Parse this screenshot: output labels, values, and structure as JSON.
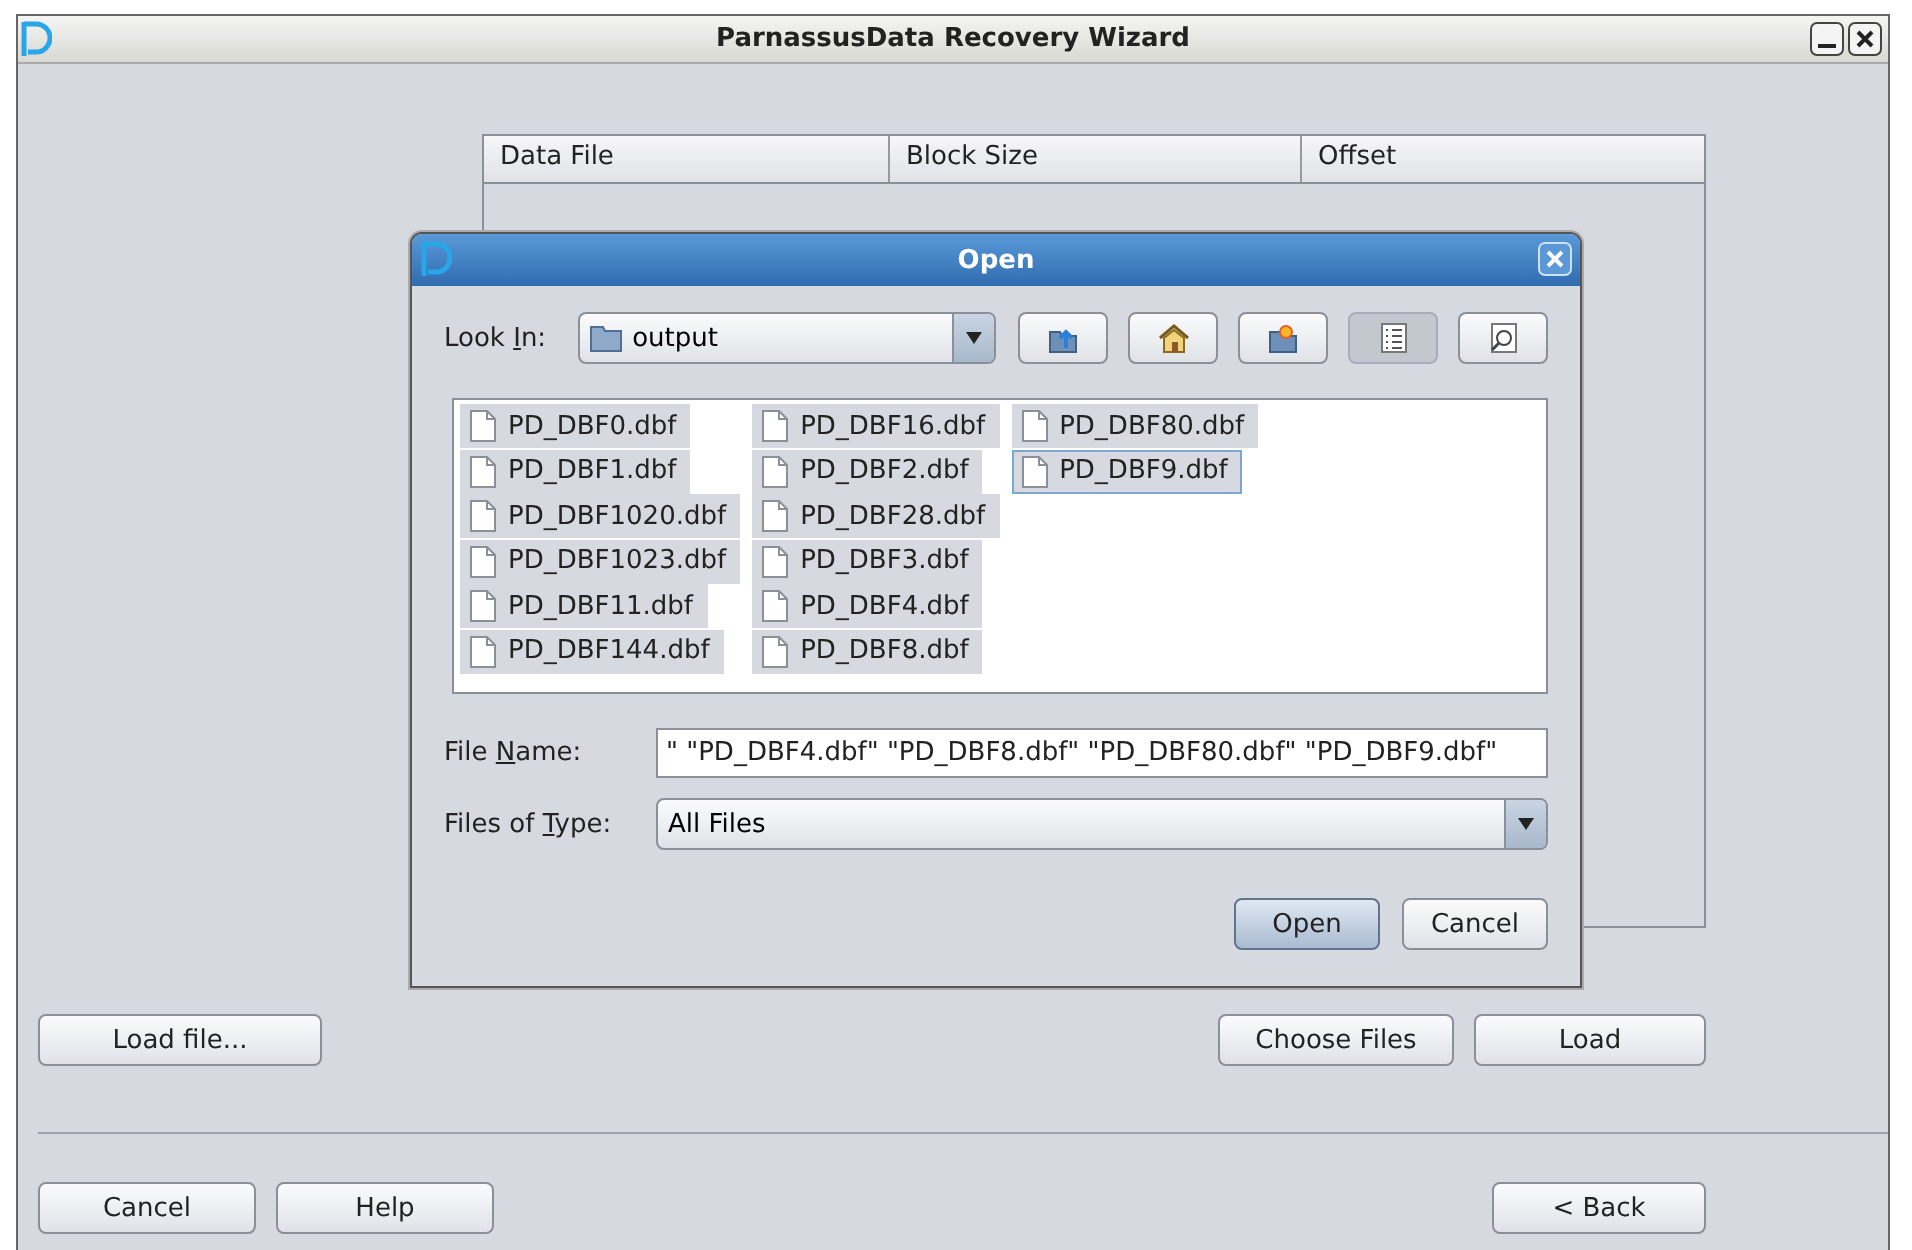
{
  "window": {
    "title": "ParnassusData Recovery Wizard"
  },
  "table": {
    "columns": [
      "Data File",
      "Block Size",
      "Offset"
    ]
  },
  "dialog": {
    "title": "Open",
    "look_in": {
      "label": [
        "Look ",
        "I",
        "n:"
      ],
      "value": "output"
    },
    "toolbar": [
      {
        "kind": "up",
        "selected": false
      },
      {
        "kind": "home",
        "selected": false
      },
      {
        "kind": "new-folder",
        "selected": false
      },
      {
        "kind": "list",
        "selected": true
      },
      {
        "kind": "details",
        "selected": false
      }
    ],
    "files": [
      {
        "name": "PD_DBF0.dbf",
        "selected": true,
        "focused": false
      },
      {
        "name": "PD_DBF1.dbf",
        "selected": true,
        "focused": false
      },
      {
        "name": "PD_DBF1020.dbf",
        "selected": true,
        "focused": false
      },
      {
        "name": "PD_DBF1023.dbf",
        "selected": true,
        "focused": false
      },
      {
        "name": "PD_DBF11.dbf",
        "selected": true,
        "focused": false
      },
      {
        "name": "PD_DBF144.dbf",
        "selected": true,
        "focused": false
      },
      {
        "name": "PD_DBF16.dbf",
        "selected": true,
        "focused": false
      },
      {
        "name": "PD_DBF2.dbf",
        "selected": true,
        "focused": false
      },
      {
        "name": "PD_DBF28.dbf",
        "selected": true,
        "focused": false
      },
      {
        "name": "PD_DBF3.dbf",
        "selected": true,
        "focused": false
      },
      {
        "name": "PD_DBF4.dbf",
        "selected": true,
        "focused": false
      },
      {
        "name": "PD_DBF8.dbf",
        "selected": true,
        "focused": false
      },
      {
        "name": "PD_DBF80.dbf",
        "selected": true,
        "focused": false
      },
      {
        "name": "PD_DBF9.dbf",
        "selected": true,
        "focused": true
      }
    ],
    "file_name": {
      "label": [
        "File ",
        "N",
        "ame:"
      ],
      "value": "\" \"PD_DBF4.dbf\" \"PD_DBF8.dbf\" \"PD_DBF80.dbf\" \"PD_DBF9.dbf\""
    },
    "file_type": {
      "label": [
        "Files of ",
        "T",
        "ype:"
      ],
      "value": "All Files"
    },
    "buttons": [
      {
        "label": "Open",
        "default": true
      },
      {
        "label": "Cancel",
        "default": false
      }
    ]
  },
  "buttons": [
    "Load file...",
    "Choose Files",
    "Load"
  ],
  "footer_buttons": [
    "Cancel",
    "Help",
    "< Back"
  ]
}
